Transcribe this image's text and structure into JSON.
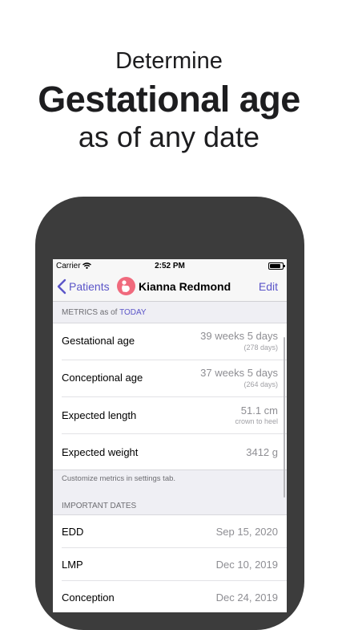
{
  "headline": {
    "line1": "Determine",
    "line2": "Gestational age",
    "line3": "as of any date"
  },
  "status_bar": {
    "carrier": "Carrier",
    "time": "2:52 PM"
  },
  "nav": {
    "back_label": "Patients",
    "title": "Kianna Redmond",
    "edit_label": "Edit",
    "avatar_color": "#f06a7d",
    "tint_color": "#5b55c8"
  },
  "metrics": {
    "header_prefix": "METRICS as of",
    "header_link": "TODAY",
    "rows": [
      {
        "label": "Gestational age",
        "value": "39 weeks 5 days",
        "sub": "(278 days)"
      },
      {
        "label": "Conceptional age",
        "value": "37 weeks 5 days",
        "sub": "(264 days)"
      },
      {
        "label": "Expected length",
        "value": "51.1 cm",
        "sub": "crown to heel"
      },
      {
        "label": "Expected weight",
        "value": "3412 g",
        "sub": ""
      }
    ],
    "footnote": "Customize metrics in settings tab."
  },
  "dates": {
    "header": "IMPORTANT DATES",
    "rows": [
      {
        "label": "EDD",
        "value": "Sep 15, 2020"
      },
      {
        "label": "LMP",
        "value": "Dec 10, 2019"
      },
      {
        "label": "Conception",
        "value": "Dec 24, 2019"
      }
    ]
  }
}
